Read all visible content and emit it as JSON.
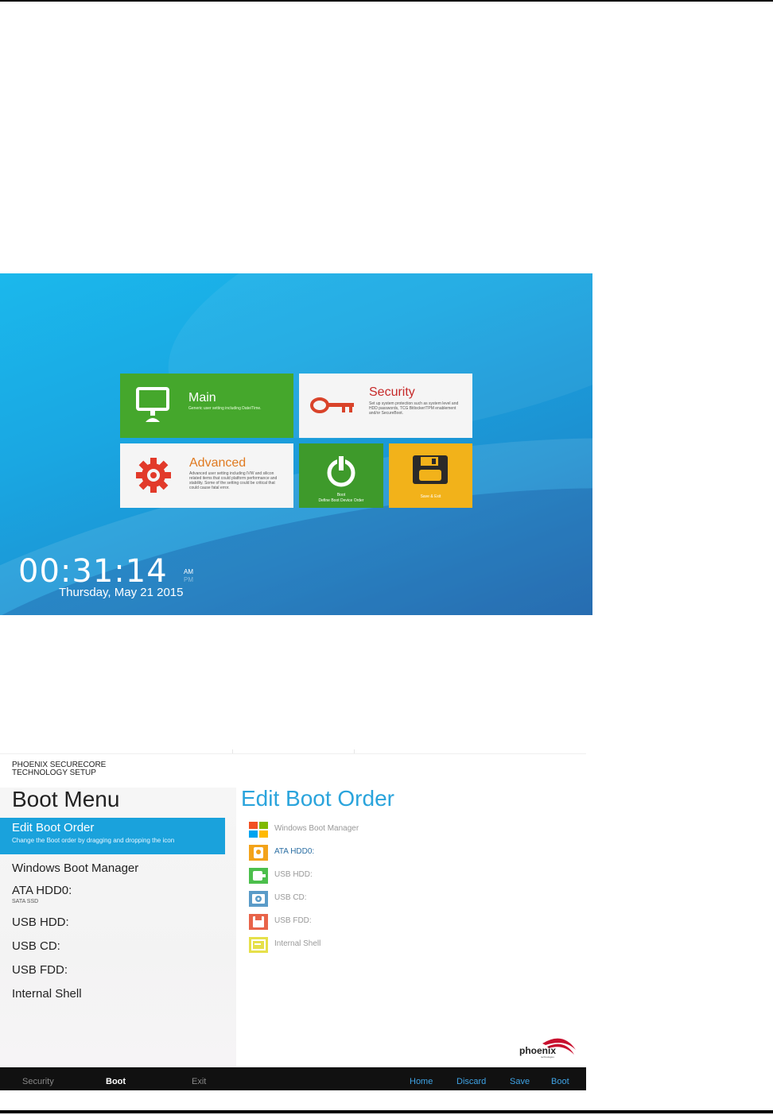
{
  "setup_home": {
    "tiles": {
      "main": {
        "title": "Main",
        "desc": "Generic user setting including Date/Time."
      },
      "security": {
        "title": "Security",
        "desc": "Set up system protection such as system level and HDD passwords, TCG Bitlocker/TPM enablement and/or SecureBoot."
      },
      "advanced": {
        "title": "Advanced",
        "desc": "Advanced user setting including IVW and silicon related items that could platform performance and stability. Some of the setting could be critical that could cause fatal error."
      },
      "boot": {
        "title": "Boot",
        "desc": "Define Boot Device Order"
      },
      "save_exit": {
        "title": "Save & Exit"
      }
    },
    "clock": {
      "time": "00:31:14",
      "am": "AM",
      "pm": "PM",
      "date": "Thursday, May 21 2015"
    },
    "colors": {
      "main": "#45a72c",
      "security_text": "#c62a2a",
      "advanced_text": "#e07a20",
      "boot": "#3e9a2b",
      "save_exit": "#f2b21a",
      "background": "#1aa7e2"
    }
  },
  "boot_menu": {
    "brand_line1": "PHOENIX SECURECORE",
    "brand_line2": "TECHNOLOGY SETUP",
    "title": "Boot Menu",
    "selected": {
      "label": "Edit Boot Order",
      "sub": "Change the Boot order by dragging and dropping the icon"
    },
    "left_items": [
      {
        "label": "Windows Boot Manager"
      },
      {
        "label": "ATA HDD0:",
        "sub": "SATA SSD"
      },
      {
        "label": "USB HDD:"
      },
      {
        "label": "USB CD:"
      },
      {
        "label": "USB FDD:"
      },
      {
        "label": "Internal Shell"
      }
    ],
    "edit_title": "Edit Boot Order",
    "order": [
      {
        "label": "Windows Boot Manager",
        "icon": "windows-icon"
      },
      {
        "label": "ATA HDD0:",
        "icon": "hdd-icon"
      },
      {
        "label": "USB HDD:",
        "icon": "usb-hdd-icon"
      },
      {
        "label": "USB CD:",
        "icon": "cd-icon"
      },
      {
        "label": "USB FDD:",
        "icon": "floppy-icon"
      },
      {
        "label": "Internal Shell",
        "icon": "shell-icon"
      }
    ],
    "logo": {
      "word": "phoenix",
      "sub": "technologies"
    },
    "bottom_bar": {
      "left": [
        "Security",
        "Boot",
        "Exit"
      ],
      "right": [
        "Home",
        "Discard",
        "Save",
        "Boot"
      ]
    },
    "colors": {
      "accent": "#1aa2dc",
      "bar": "#111111",
      "bar_link": "#3fa4e6"
    }
  }
}
